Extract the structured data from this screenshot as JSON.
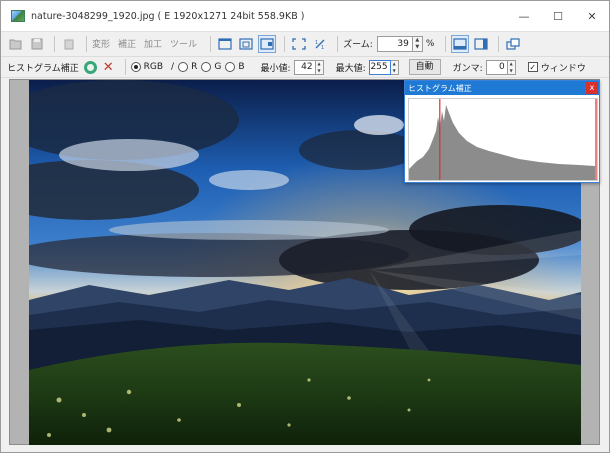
{
  "window": {
    "title": "nature-3048299_1920.jpg ( E  1920x1271  24bit  558.9KB )",
    "controls": {
      "minimize": "—",
      "maximize": "☐",
      "close": "✕"
    }
  },
  "toolbar": {
    "menu_items": [
      "変形",
      "補正",
      "加工",
      "ツール"
    ],
    "zoom_label": "ズーム:",
    "zoom_value": "39",
    "zoom_unit": "%"
  },
  "histogram_bar": {
    "title": "ヒストグラム補正",
    "channels": [
      "RGB",
      "R",
      "G",
      "B"
    ],
    "selected_channel": "RGB",
    "separator": "/",
    "min_label": "最小値:",
    "min_value": "42",
    "max_label": "最大値:",
    "max_value": "255",
    "auto_button": "自動",
    "gamma_label": "ガンマ:",
    "gamma_value": "0",
    "window_checkbox_label": "ウィンドウ",
    "window_checked": true
  },
  "histogram_window": {
    "title": "ヒストグラム補正",
    "close": "x",
    "min_marker": 42,
    "max_marker": 255
  },
  "colors": {
    "accent": "#1f7ad6",
    "confirm": "#36a87a",
    "cancel": "#c0392b",
    "marker": "#d9302d"
  },
  "icons": {
    "app": "image-viewer-icon",
    "open": "folder-open-icon",
    "save": "save-icon",
    "delete": "trash-icon",
    "fit_window": "fit-window-icon",
    "fit_image": "fit-image-icon",
    "actual_size": "actual-size-icon",
    "fullscreen": "fullscreen-icon",
    "rotate": "rotate-icon",
    "confirm": "check-circle-icon",
    "cancel": "x-icon"
  }
}
